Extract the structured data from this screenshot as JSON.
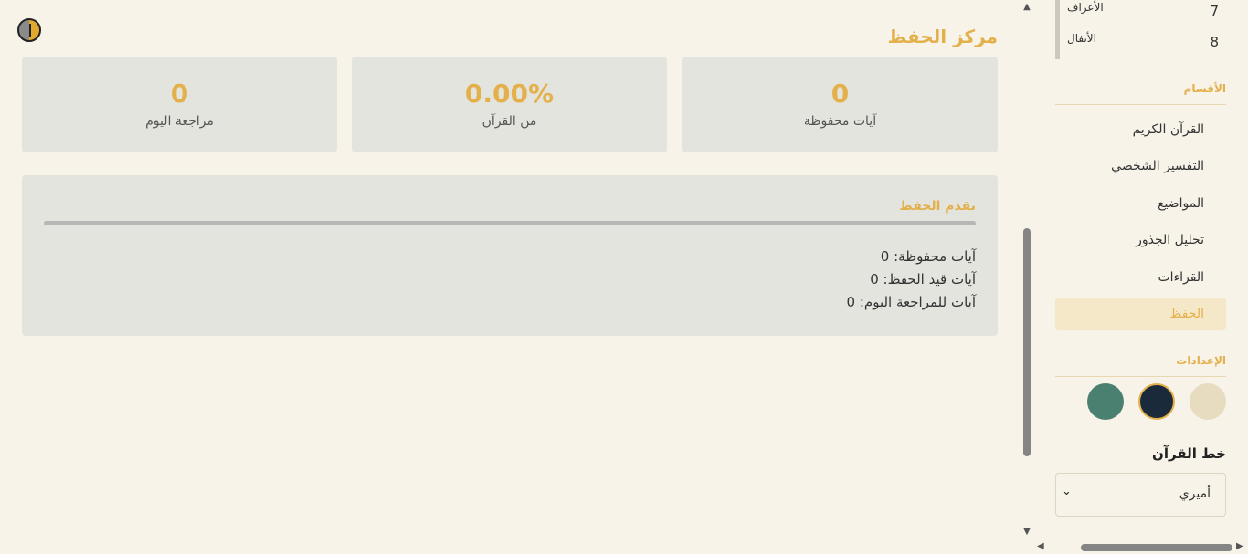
{
  "main": {
    "title": "مركز الحفظ",
    "stats": [
      {
        "value": "0",
        "label": "آيات محفوظة"
      },
      {
        "value": "0.00%",
        "label": "من القرآن"
      },
      {
        "value": "0",
        "label": "مراجعة اليوم"
      }
    ],
    "progress": {
      "title": "تقدم الحفظ",
      "percent": 0,
      "lines": [
        "آيات محفوظة: 0",
        "آيات قيد الحفظ: 0",
        "آيات للمراجعة اليوم: 0"
      ]
    }
  },
  "sidebar": {
    "surahs": [
      {
        "number": "7",
        "name": "الأعراف"
      },
      {
        "number": "8",
        "name": "الأنفال"
      }
    ],
    "sections_label": "الأقسام",
    "nav": [
      {
        "label": "القرآن الكريم"
      },
      {
        "label": "التفسير الشخصي"
      },
      {
        "label": "المواضيع"
      },
      {
        "label": "تحليل الجذور"
      },
      {
        "label": "القراءات"
      },
      {
        "label": "الحفظ"
      }
    ],
    "settings_label": "الإعدادات",
    "themes": [
      {
        "name": "light",
        "color": "#e8dcc0"
      },
      {
        "name": "dark",
        "color": "#1b2a3a"
      },
      {
        "name": "green",
        "color": "#4a8070"
      }
    ],
    "font_heading": "خط القرآن",
    "font_value": "أميري"
  },
  "colors": {
    "accent": "#e3b04b",
    "active_border": "#e3b04b"
  }
}
